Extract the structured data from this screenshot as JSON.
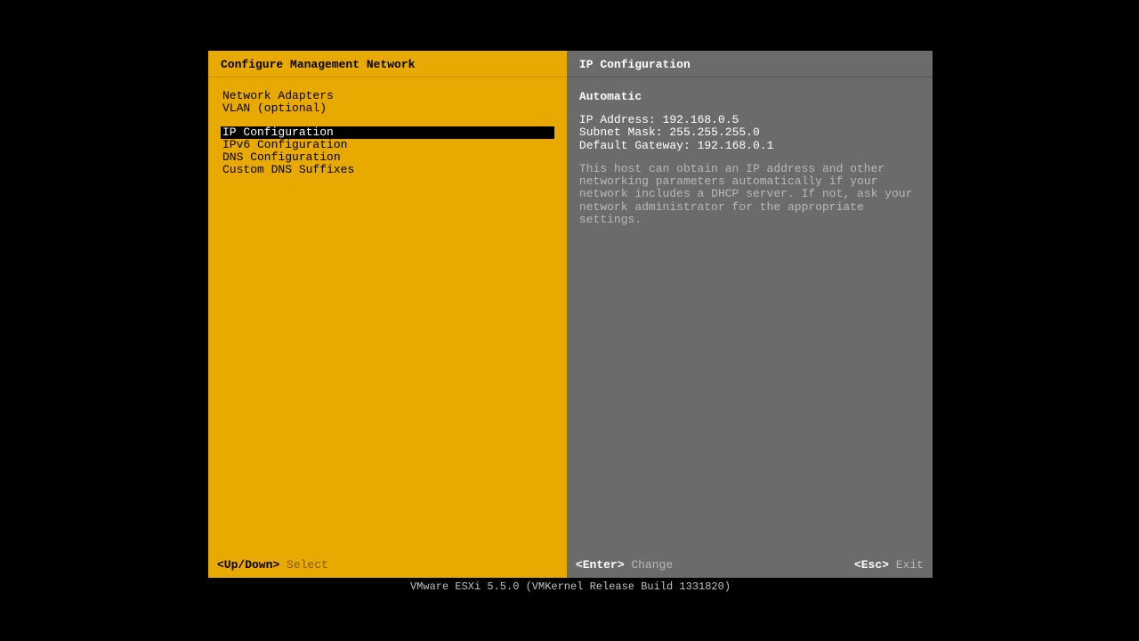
{
  "left": {
    "title": "Configure Management Network",
    "groups": [
      [
        {
          "label": "Network Adapters",
          "selected": false
        },
        {
          "label": "VLAN (optional)",
          "selected": false
        }
      ],
      [
        {
          "label": "IP Configuration",
          "selected": true
        },
        {
          "label": "IPv6 Configuration",
          "selected": false
        },
        {
          "label": "DNS Configuration",
          "selected": false
        },
        {
          "label": "Custom DNS Suffixes",
          "selected": false
        }
      ]
    ],
    "footer_key": "<Up/Down>",
    "footer_action": "Select"
  },
  "right": {
    "title": "IP Configuration",
    "mode": "Automatic",
    "ip_label": "IP Address:",
    "ip_value": "192.168.0.5",
    "mask_label": "Subnet Mask:",
    "mask_value": "255.255.255.0",
    "gw_label": "Default Gateway:",
    "gw_value": "192.168.0.1",
    "help": "This host can obtain an IP address and other networking parameters automatically if your network includes a DHCP server. If not, ask your network administrator for the appropriate settings.",
    "footer_left_key": "<Enter>",
    "footer_left_action": "Change",
    "footer_right_key": "<Esc>",
    "footer_right_action": "Exit"
  },
  "status": "VMware ESXi 5.5.0 (VMKernel Release Build 1331820)"
}
